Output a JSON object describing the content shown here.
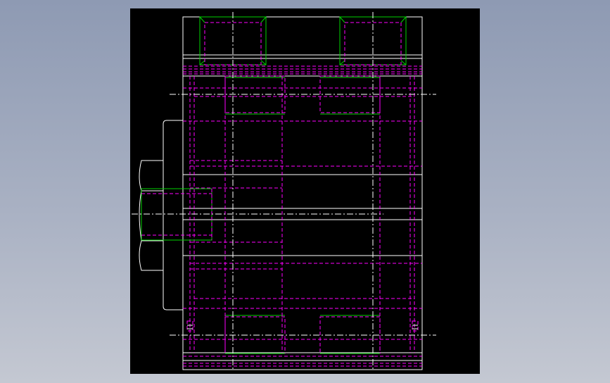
{
  "viewport": {
    "background": "#000000",
    "page_background": "#a9b1c3"
  },
  "line_colors": {
    "visible": "#ffffff",
    "hidden": "#ff00ff",
    "highlight": "#00d200",
    "centerline": "#ffffff"
  },
  "drawing": {
    "view": "front",
    "visible_text": []
  }
}
